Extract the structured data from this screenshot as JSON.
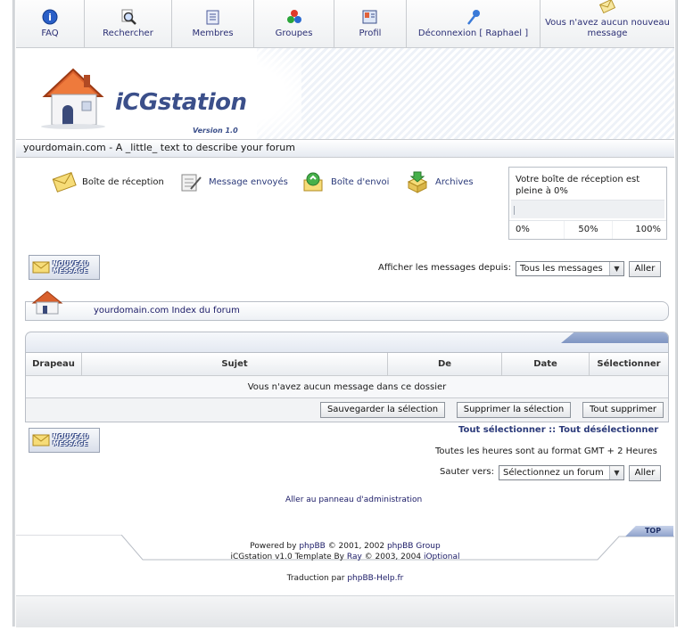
{
  "nav": {
    "faq": "FAQ",
    "search": "Rechercher",
    "members": "Membres",
    "groups": "Groupes",
    "profile": "Profil",
    "logout": "Déconnexion [ Raphael ]",
    "messages_line1": "Vous n'avez aucun nouveau",
    "messages_line2": "message"
  },
  "header": {
    "logo": "iCGstation",
    "version": "Version 1.0",
    "description": "yourdomain.com - A _little_ text to describe your forum"
  },
  "folders": {
    "inbox": "Boîte de réception",
    "sent": "Message envoyés",
    "outbox": "Boîte d'envoi",
    "archives": "Archives"
  },
  "quota": {
    "line1": "Votre boîte de réception est",
    "line2": "pleine à 0%",
    "fill_percent": 0,
    "scale": [
      "0%",
      "50%",
      "100%"
    ]
  },
  "new_message_btn": {
    "line1": "NOUVEAU",
    "line2": "MESSAGE"
  },
  "filter": {
    "label": "Afficher les messages depuis:",
    "selected": "Tous les messages",
    "go": "Aller"
  },
  "breadcrumb": "yourdomain.com Index du forum",
  "table": {
    "columns": [
      "Drapeau",
      "Sujet",
      "De",
      "Date",
      "Sélectionner"
    ],
    "empty": "Vous n'avez aucun message dans ce dossier",
    "save_selection": "Sauvegarder la sélection",
    "delete_selection": "Supprimer la sélection",
    "delete_all": "Tout supprimer"
  },
  "select_all": "Tout sélectionner",
  "separator": "::",
  "deselect_all": "Tout désélectionner",
  "timezone": "Toutes les heures sont au format GMT + 2 Heures",
  "jump": {
    "label": "Sauter vers:",
    "selected": "Sélectionnez un forum",
    "go": "Aller"
  },
  "admin_link": "Aller au panneau d'administration",
  "top": "TOP",
  "footer": {
    "powered_prefix": "Powered by",
    "phpbb": "phpBB",
    "powered_mid": "© 2001, 2002",
    "phpbb_group": "phpBB Group",
    "template_prefix": "iCGstation v1.0 Template By",
    "ray": "Ray",
    "template_mid": "© 2003, 2004",
    "ioptional": "iOptional",
    "translation_prefix": "Traduction par",
    "translation_link": "phpBB-Help.fr"
  }
}
